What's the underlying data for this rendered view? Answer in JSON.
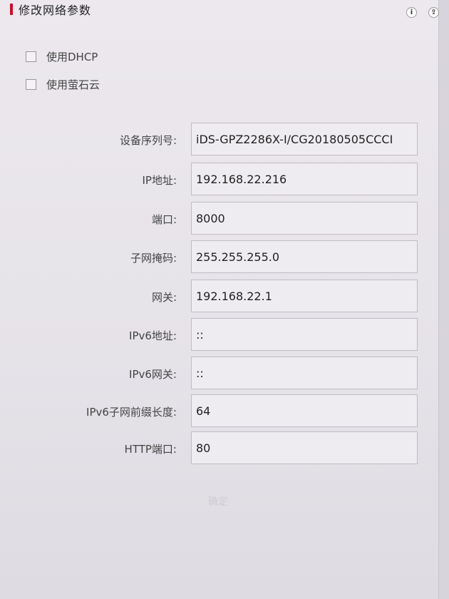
{
  "header": {
    "title": "修改网络参数"
  },
  "top_icons": [
    {
      "icon": "info-icon",
      "glyph": "i"
    },
    {
      "icon": "share-icon",
      "glyph": "⇪"
    }
  ],
  "options": [
    {
      "label": "使用DHCP",
      "checked": false
    },
    {
      "label": "使用萤石云",
      "checked": false
    }
  ],
  "fields": [
    {
      "label": "设备序列号:",
      "value": "iDS-GPZ2286X-I/CG20180505CCCI"
    },
    {
      "label": "IP地址:",
      "value": "192.168.22.216"
    },
    {
      "label": "端口:",
      "value": "8000"
    },
    {
      "label": "子网掩码:",
      "value": "255.255.255.0"
    },
    {
      "label": "网关:",
      "value": "192.168.22.1"
    },
    {
      "label": "IPv6地址:",
      "value": "::"
    },
    {
      "label": "IPv6网关:",
      "value": "::"
    },
    {
      "label": "IPv6子网前缀长度:",
      "value": "64"
    },
    {
      "label": "HTTP端口:",
      "value": "80"
    }
  ],
  "confirm_button": {
    "label": "确定"
  },
  "colors": {
    "accent": "#c8102e",
    "background": "#e9e5ea",
    "input_border": "#bfbbc3"
  }
}
